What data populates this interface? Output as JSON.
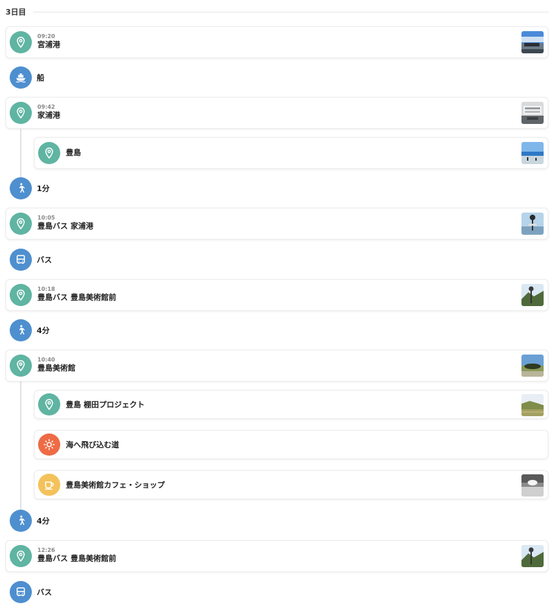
{
  "day_title": "3日目",
  "stops": {
    "miyanoura": {
      "time": "09:20",
      "name": "宮浦港"
    },
    "ieura": {
      "time": "09:42",
      "name": "家浦港"
    },
    "teshima": {
      "name": "豊島"
    },
    "bus_ieura": {
      "time": "10:05",
      "name": "豊島バス 家浦港"
    },
    "bus_museum_1": {
      "time": "10:18",
      "name": "豊島バス 豊島美術館前"
    },
    "museum": {
      "time": "10:40",
      "name": "豊島美術館"
    },
    "tanada": {
      "name": "豊島 棚田プロジェクト"
    },
    "sea_road": {
      "name": "海へ飛び込む道"
    },
    "cafe": {
      "name": "豊島美術館カフェ・ショップ"
    },
    "bus_museum_2": {
      "time": "12:26",
      "name": "豊島バス 豊島美術館前"
    }
  },
  "moves": {
    "ship": "船",
    "walk1": "1分",
    "bus1": "バス",
    "walk2": "4分",
    "walk3": "4分",
    "bus2": "バス"
  },
  "icons": {
    "place": "map-pin-icon",
    "ship": "ship-icon",
    "walk": "walking-person-icon",
    "bus": "bus-icon",
    "sun": "sun-icon",
    "cafe": "coffee-cup-icon"
  },
  "colors": {
    "place": "#5fb4a2",
    "move": "#4e8fcf",
    "sun": "#ee6b45",
    "cafe": "#f4c25a"
  }
}
